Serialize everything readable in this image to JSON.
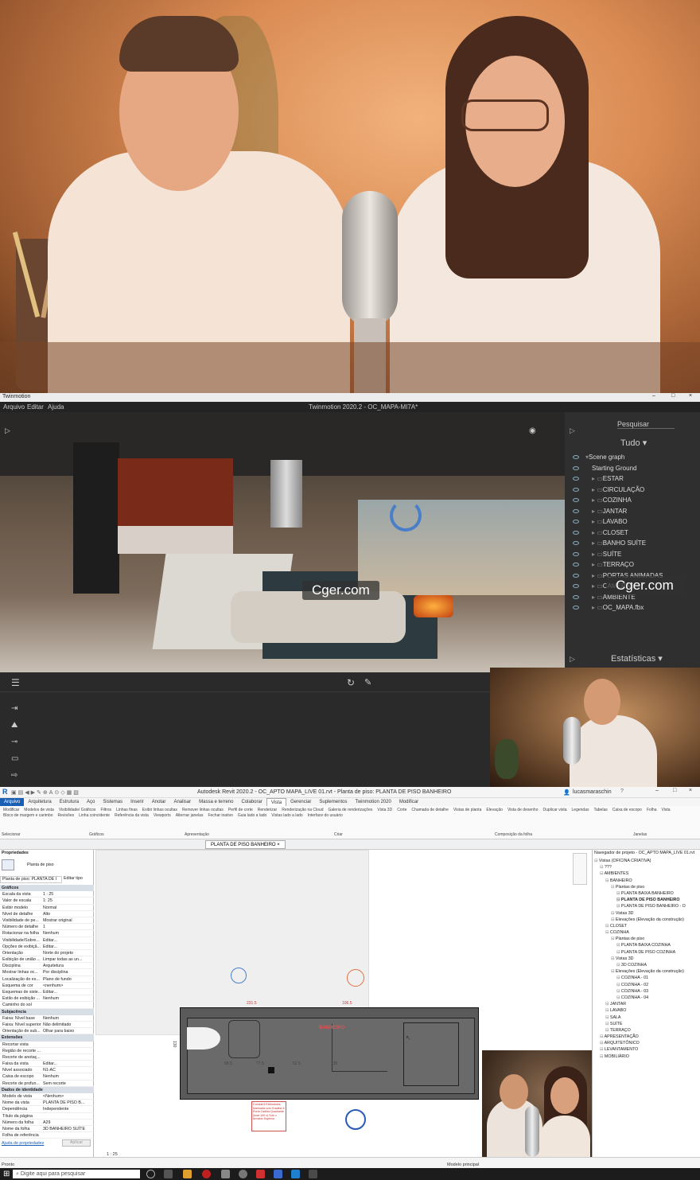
{
  "twinmotion": {
    "window_title": "Twinmotion",
    "app_title": "Twinmotion 2020.2 - OC_MAPA-MI7A*",
    "menu": [
      "Arquivo",
      "Editar",
      "Ajuda"
    ],
    "search_label": "Pesquisar",
    "filter_value": "Tudo",
    "stats_label": "Estatísticas",
    "watermark": "Cger.com",
    "scene_tree": [
      "Scene graph",
      "Starting Ground",
      "ESTAR",
      "CIRCULAÇÃO",
      "COZINHA",
      "JANTAR",
      "LAVABO",
      "CLOSET",
      "BANHO SUÍTE",
      "SUÍTE",
      "TERRAÇO",
      "PORTAS ANIMADAS",
      "CAMERAS",
      "AMBIENTE",
      "OC_MAPA.fbx"
    ]
  },
  "revit": {
    "app_title": "Autodesk Revit 2020.2 - OC_APTO MAPA_LIVE 01.rvt - Planta de piso: PLANTA DE PISO BANHEIRO",
    "user": "lucasmaraschin",
    "tabs": [
      "Arquivo",
      "Arquitetura",
      "Estrutura",
      "Aço",
      "Sistemas",
      "Inserir",
      "Anotar",
      "Analisar",
      "Massa e terreno",
      "Colaborar",
      "Vista",
      "Gerenciar",
      "Suplementos",
      "Twinmotion 2020",
      "Modificar"
    ],
    "ribbon_groups": [
      "Selecionar",
      "Gráficos",
      "Apresentação",
      "Criar",
      "Composição da folha",
      "Janelas"
    ],
    "ribbon_items": [
      "Modificar",
      "Modelos de vista",
      "Visibilidade/ Gráficos",
      "Filtros",
      "Linhas finas",
      "Exibir linhas ocultas",
      "Remover linhas ocultas",
      "Perfil de corte",
      "Renderizar",
      "Renderização na Cloud",
      "Galeria de renderizações",
      "Vista 3D",
      "Corte",
      "Chamada de detalhe",
      "Vistas de planta",
      "Elevação",
      "Vista de desenho",
      "Duplicar vista",
      "Legendas",
      "Tabelas",
      "Caixa de escopo",
      "Folha",
      "Vista",
      "Bloco de margem e carimbo",
      "Revisões",
      "Linha coincidente",
      "Referência da vista",
      "Viewports",
      "Alternar janelas",
      "Fechar inativo",
      "Guia lado a lado",
      "Vistas lado a lado",
      "Interface do usuário"
    ],
    "view_tab": "PLANTA DE PISO BANHEIRO",
    "properties": {
      "title": "Propriedades",
      "type_name": "Planta de piso",
      "selector": "Planta de piso: PLANTA DE I",
      "edit_type": "Editar tipo",
      "sections": [
        {
          "name": "Gráficos",
          "rows": [
            [
              "Escala da vista",
              "1 : 25"
            ],
            [
              "Valor de escala",
              "1: 25"
            ],
            [
              "Exibir modelo",
              "Normal"
            ],
            [
              "Nível de detalhe",
              "Alto"
            ],
            [
              "Visibilidade de pe...",
              "Mostrar original"
            ],
            [
              "Número de detalhe",
              "1"
            ],
            [
              "Rotacionar na folha",
              "Nenhum"
            ],
            [
              "Visibilidade/Sobre...",
              "Editar..."
            ],
            [
              "Opções de exibiçã...",
              "Editar..."
            ],
            [
              "Orientação",
              "Norte do projeto"
            ],
            [
              "Exibição de união ...",
              "Limpar todas as un..."
            ],
            [
              "Disciplina",
              "Arquitetura"
            ],
            [
              "Mostrar linhas oc...",
              "Por disciplina"
            ],
            [
              "Localização do es...",
              "Plano de fundo"
            ],
            [
              "Esquema de cor",
              "<nenhum>"
            ],
            [
              "Esquemas de siste...",
              "Editar..."
            ],
            [
              "Estilo de exibição ...",
              "Nenhum"
            ],
            [
              "Caminho do sol",
              ""
            ]
          ]
        },
        {
          "name": "Subjacência",
          "rows": [
            [
              "Faixa: Nível base",
              "Nenhum"
            ],
            [
              "Faixa: Nível superior",
              "Não delimitado"
            ],
            [
              "Orientação de sub...",
              "Olhar para baixo"
            ]
          ]
        },
        {
          "name": "Extensões",
          "rows": [
            [
              "Recortar vista",
              ""
            ],
            [
              "Região de recorte ...",
              ""
            ],
            [
              "Recorte de anotaç...",
              ""
            ],
            [
              "Faixa da vista",
              "Editar..."
            ],
            [
              "Nível associado",
              "N1-AC"
            ],
            [
              "Caixa de escopo",
              "Nenhum"
            ],
            [
              "Recorte de profun...",
              "Sem recorte"
            ]
          ]
        },
        {
          "name": "Dados de identidade",
          "rows": [
            [
              "Modelo de vista",
              "<Nenhum>"
            ],
            [
              "Nome da vista",
              "PLANTA DE PISO B..."
            ],
            [
              "Dependência",
              "Independente"
            ],
            [
              "Título da página",
              ""
            ],
            [
              "Número da folha",
              "A29"
            ],
            [
              "Nome da folha",
              "3D BANHEIRO SUÍTE"
            ],
            [
              "Folha de referência",
              ""
            ]
          ]
        }
      ],
      "help_link": "Ajuda de propriedades",
      "apply": "Aplicar"
    },
    "browser": {
      "title": "Navegador de projeto - OC_APTO MAPA_LIVE 01.rvt",
      "items": [
        "Vistas (OFICINA CRIATIVA)",
        "???",
        "AMBIENTES",
        "BANHEIRO",
        "Plantas de piso",
        "PLANTA BAIXA BANHEIRO",
        "PLANTA DE PISO BANHEIRO",
        "PLANTA DE PISO BANHEIRO - O",
        "Vistas 3D",
        "Elevações (Elevação da construção)",
        "CLOSET",
        "COZINHA",
        "Plantas de piso",
        "PLANTA BAIXA COZINHA",
        "PLANTA DE PISO COZINHA",
        "Vistas 3D",
        "3D COZINHA",
        "Elevações (Elevação da construção)",
        "COZINHA - 01",
        "COZINHA - 02",
        "COZINHA - 03",
        "COZINHA - 04",
        "JANTAR",
        "LAVABO",
        "SALA",
        "SUÍTE",
        "TERRAÇO",
        "APRESENTAÇÃO",
        "ARQUITETÔNICO",
        "LEVANTAMENTO",
        "MOBILIÁRIO"
      ]
    },
    "drawing": {
      "room_label": "BANHEIRO",
      "dim_left": "130",
      "dim_top_a": "231.5",
      "dim_top_b": "106.5",
      "dim_bottom_a": "58.5",
      "dim_bottom_b": "77.5",
      "dim_bottom_c": "52.5",
      "dim_bottom_d": "135",
      "note": "Conduit 8 Eletrodutos Marinada com Gradine & Porta Cadiha Quadrante (Instr 100 x) Sob o Armário Superior"
    },
    "status": {
      "ready": "Pronto",
      "scale": "1 : 25",
      "model": "Modelo principal"
    },
    "taskbar_search": "Digite aqui para pesquisar"
  }
}
